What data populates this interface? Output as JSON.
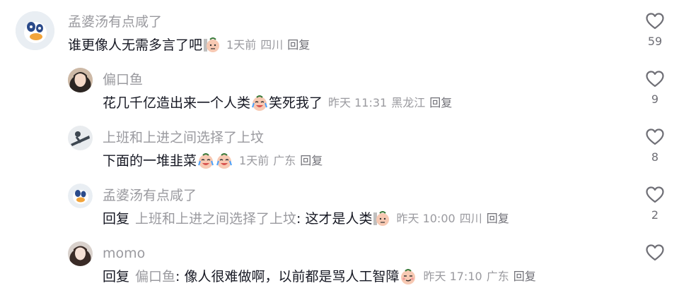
{
  "comments": [
    {
      "username": "孟婆汤有点咸了",
      "text": "谁更像人无需多言了吧",
      "time": "1天前",
      "location": "四川",
      "reply_label": "回复",
      "likes": "59"
    },
    {
      "username": "偏口鱼",
      "text": "花几千亿造出来一个人类",
      "text_after": "笑死我了",
      "time": "昨天 11:31",
      "location": "黑龙江",
      "reply_label": "回复",
      "likes": "9"
    },
    {
      "username": "上班和上进之间选择了上坟",
      "text": "下面的一堆韭菜",
      "time": "1天前",
      "location": "广东",
      "reply_label": "回复",
      "likes": "8"
    },
    {
      "username": "孟婆汤有点咸了",
      "reply_prefix": "回复",
      "mention": "上班和上进之间选择了上坟",
      "text": ": 这才是人类",
      "time": "昨天 10:00",
      "location": "四川",
      "reply_label": "回复",
      "likes": "2"
    },
    {
      "username": "momo",
      "reply_prefix": "回复",
      "mention": "偏口鱼",
      "text": ": 像人很难做啊，以前都是骂人工智障",
      "time": "昨天 17:10",
      "location": "广东",
      "reply_label": "回复",
      "likes": ""
    }
  ],
  "colors": {
    "text": "#161823",
    "secondary": "#9a9a9f",
    "icon": "#6f6f76"
  },
  "icons": {
    "like": "heart-outline-icon",
    "emoji_awkward": "awkward-emoji",
    "emoji_laugh_cry": "laugh-cry-emoji",
    "emoji_smirk": "smirk-emoji"
  }
}
